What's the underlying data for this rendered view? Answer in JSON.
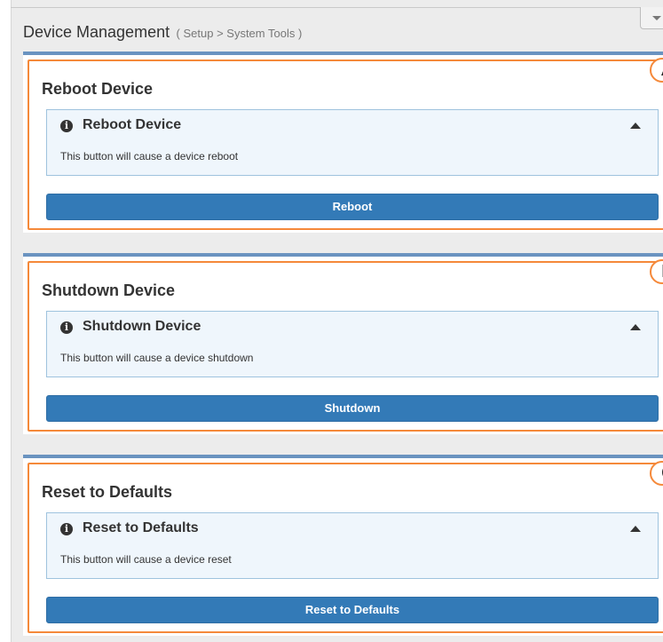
{
  "header": {
    "title": "Device Management",
    "breadcrumb": "( Setup > System Tools )"
  },
  "sections": [
    {
      "callout": "A",
      "heading": "Reboot Device",
      "panel_title": "Reboot Device",
      "panel_text": "This button will cause a device reboot",
      "button_label": "Reboot"
    },
    {
      "callout": "B",
      "heading": "Shutdown Device",
      "panel_title": "Shutdown Device",
      "panel_text": "This button will cause a device shutdown",
      "button_label": "Shutdown"
    },
    {
      "callout": "C",
      "heading": "Reset to Defaults",
      "panel_title": "Reset to Defaults",
      "panel_text": "This button will cause a device reset",
      "button_label": "Reset to Defaults"
    }
  ],
  "icons": {
    "info": "info-icon",
    "collapse": "chevron-up-icon",
    "menu_toggle": "chevron-down-icon"
  },
  "colors": {
    "primary_button": "#337ab7",
    "annotation_outline": "#f5893a",
    "card_top_border": "#6a93c0",
    "info_panel_bg": "#eff6fc",
    "info_panel_border": "#9fc3de"
  }
}
